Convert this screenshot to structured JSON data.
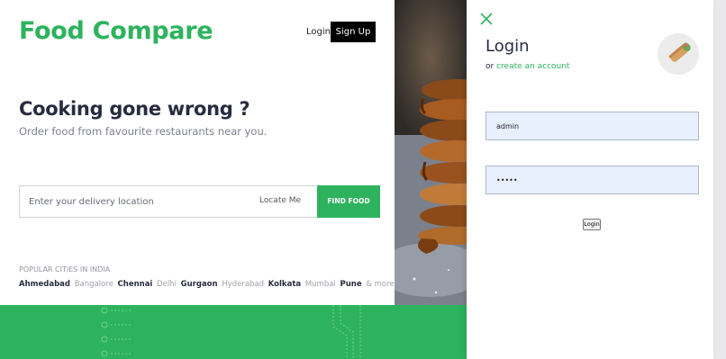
{
  "header": {
    "brand": "Food Compare",
    "login_label": "Login",
    "signup_label": "Sign Up"
  },
  "hero": {
    "title": "Cooking gone wrong ?",
    "subtitle": "Order food from favourite restaurants near you."
  },
  "search": {
    "placeholder": "Enter your delivery location",
    "locate_label": "Locate Me",
    "find_label": "FIND FOOD"
  },
  "popular": {
    "title": "POPULAR CITIES IN INDIA",
    "cities": [
      {
        "name": "Ahmedabad",
        "style": "dark"
      },
      {
        "name": "Bangalore",
        "style": "light"
      },
      {
        "name": "Chennai",
        "style": "dark"
      },
      {
        "name": "Delhi",
        "style": "light"
      },
      {
        "name": "Gurgaon",
        "style": "dark"
      },
      {
        "name": "Hyderabad",
        "style": "light"
      },
      {
        "name": "Kolkata",
        "style": "dark"
      },
      {
        "name": "Mumbai",
        "style": "light"
      },
      {
        "name": "Pune",
        "style": "dark"
      },
      {
        "name": "& more.",
        "style": "light"
      }
    ]
  },
  "drawer": {
    "title": "Login",
    "or_label": "or",
    "create_account_label": "create an account",
    "username_value": "admin",
    "password_value": "•••••",
    "submit_label": "Login"
  },
  "colors": {
    "brand_green": "#2db35d",
    "field_bg": "#e8f0fe"
  },
  "icons": [
    "close-icon",
    "food-wrap-image"
  ]
}
